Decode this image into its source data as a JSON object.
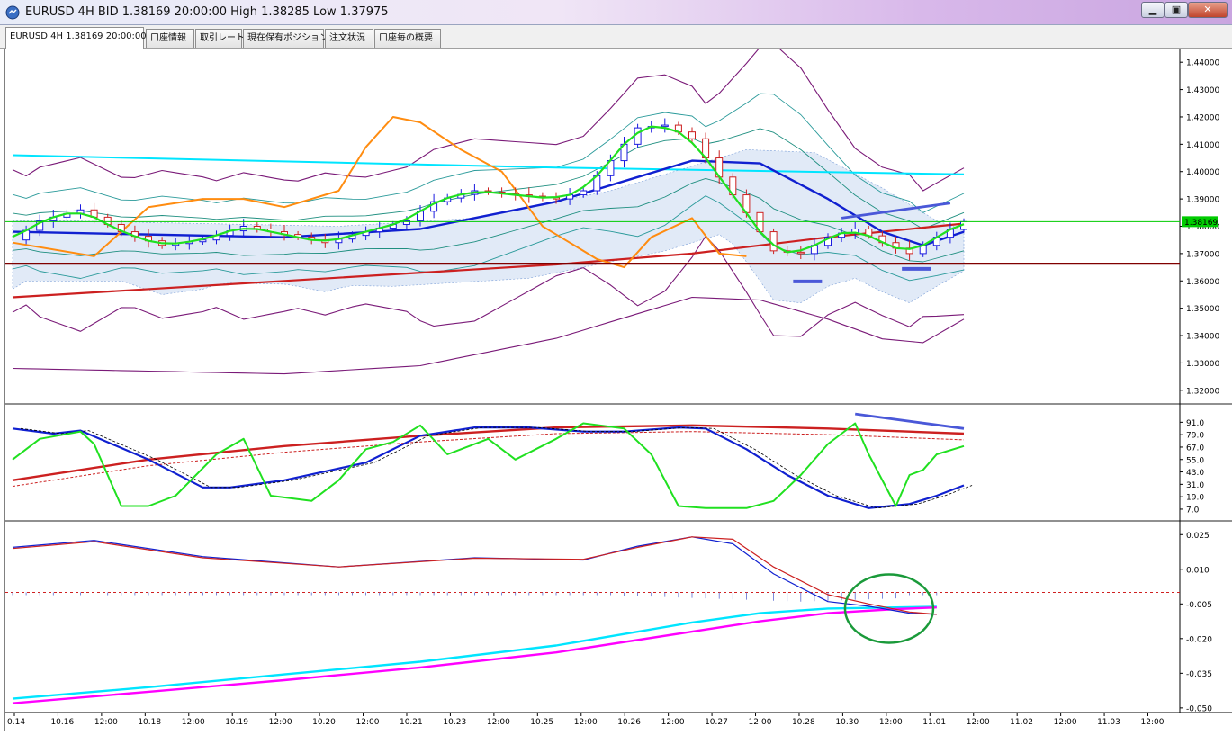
{
  "window": {
    "title": "EURUSD 4H BID 1.38169 20:00:00 High 1.38285 Low 1.37975",
    "controls": {
      "minimize": "▁",
      "maximize": "▣",
      "close": "✕"
    }
  },
  "tabs": [
    {
      "label": "EURUSD 4H 1.38169 20:00:00",
      "active": true
    },
    {
      "label": "口座情報"
    },
    {
      "label": "取引レート"
    },
    {
      "label": "現在保有ポジション"
    },
    {
      "label": "注文状況"
    },
    {
      "label": "口座毎の概要"
    }
  ],
  "chart_data": [
    {
      "type": "candlestick",
      "panel": "price",
      "symbol": "EURUSD",
      "timeframe": "4H",
      "ylim": [
        1.315,
        1.445
      ],
      "yticks": [
        "1.44000",
        "1.43000",
        "1.42000",
        "1.41000",
        "1.40000",
        "1.39000",
        "1.38000",
        "1.37000",
        "1.36000",
        "1.35000",
        "1.34000",
        "1.33000",
        "1.32000"
      ],
      "current_price_label": "1.38169",
      "current_price": 1.38169,
      "support_level": 1.3663,
      "grid": false,
      "series": [
        {
          "kind": "close_path",
          "x": [
            0,
            2,
            5,
            8,
            11,
            14,
            17,
            20,
            23,
            26,
            29,
            31,
            34,
            36,
            38,
            40,
            42,
            44,
            46,
            48,
            50,
            52,
            54,
            56,
            58,
            60,
            62,
            64,
            66,
            68,
            70
          ],
          "values": [
            1.375,
            1.382,
            1.386,
            1.378,
            1.373,
            1.375,
            1.38,
            1.377,
            1.374,
            1.378,
            1.382,
            1.389,
            1.393,
            1.392,
            1.391,
            1.39,
            1.393,
            1.404,
            1.416,
            1.417,
            1.412,
            1.398,
            1.385,
            1.371,
            1.37,
            1.376,
            1.379,
            1.374,
            1.37,
            1.376,
            1.3817
          ]
        },
        {
          "kind": "moving_average",
          "name": "long",
          "x": [
            0,
            20,
            40,
            50,
            60,
            70
          ],
          "values": [
            1.354,
            1.36,
            1.366,
            1.37,
            1.376,
            1.381
          ]
        },
        {
          "kind": "moving_average",
          "name": "mid",
          "x": [
            0,
            20,
            30,
            40,
            46,
            50,
            55,
            60,
            64,
            67,
            70
          ],
          "values": [
            1.378,
            1.376,
            1.379,
            1.389,
            1.398,
            1.404,
            1.403,
            1.39,
            1.378,
            1.373,
            1.378
          ]
        },
        {
          "kind": "horizontal_trend",
          "x": [
            0,
            40,
            70
          ],
          "values": [
            1.406,
            1.4015,
            1.399
          ]
        },
        {
          "kind": "lagging_span",
          "x": [
            0,
            6,
            10,
            14,
            17,
            20,
            24,
            26,
            28,
            30,
            33,
            36,
            39,
            41,
            43,
            45,
            47,
            50,
            52,
            54
          ],
          "values": [
            1.374,
            1.369,
            1.387,
            1.39,
            1.39,
            1.387,
            1.393,
            1.409,
            1.42,
            1.418,
            1.408,
            1.4,
            1.38,
            1.374,
            1.368,
            1.365,
            1.376,
            1.383,
            1.37,
            1.369
          ]
        }
      ],
      "trendlines": [
        {
          "x": [
            61,
            69
          ],
          "values": [
            1.383,
            1.3885
          ]
        }
      ],
      "markers": [
        {
          "x": 58.5,
          "value": 1.3598
        },
        {
          "x": 66.5,
          "value": 1.3644
        }
      ]
    },
    {
      "type": "line",
      "panel": "oscillator",
      "ylim": [
        0,
        100
      ],
      "yticks": [
        "91.0",
        "79.0",
        "67.0",
        "55.0",
        "43.0",
        "31.0",
        "19.0",
        "7.0"
      ],
      "series": [
        {
          "kind": "stochastic_fast",
          "x": [
            0,
            2,
            5,
            6,
            8,
            10,
            12,
            15,
            17,
            19,
            22,
            24,
            26,
            28,
            30,
            32,
            35,
            37,
            40,
            42,
            45,
            47,
            49,
            51,
            54,
            56,
            58,
            60,
            62,
            63,
            65,
            66,
            67,
            68,
            70
          ],
          "values": [
            55,
            75,
            82,
            70,
            10,
            10,
            20,
            60,
            75,
            20,
            15,
            35,
            65,
            72,
            88,
            60,
            75,
            55,
            75,
            90,
            85,
            60,
            10,
            8,
            8,
            15,
            40,
            70,
            90,
            60,
            10,
            40,
            45,
            60,
            68
          ]
        },
        {
          "kind": "stochastic_slow",
          "x": [
            0,
            3,
            5,
            10,
            14,
            16,
            20,
            26,
            30,
            34,
            38,
            42,
            45,
            49,
            51,
            54,
            57,
            60,
            63,
            66,
            68,
            70
          ],
          "values": [
            85,
            80,
            83,
            55,
            28,
            28,
            35,
            52,
            78,
            86,
            86,
            82,
            82,
            86,
            85,
            65,
            40,
            20,
            8,
            12,
            20,
            30
          ]
        },
        {
          "kind": "ma_red",
          "x": [
            0,
            10,
            20,
            30,
            40,
            50,
            60,
            70
          ],
          "values": [
            35,
            55,
            68,
            78,
            86,
            88,
            85,
            80
          ]
        }
      ],
      "trendlines": [
        {
          "x": [
            62,
            70
          ],
          "values": [
            99,
            85
          ]
        }
      ]
    },
    {
      "type": "line",
      "panel": "macd",
      "ylim": [
        -0.052,
        0.029
      ],
      "yticks": [
        "0.025",
        "0.010",
        "-0.005",
        "-0.020",
        "-0.035",
        "-0.050"
      ],
      "series": [
        {
          "kind": "main",
          "x": [
            0,
            6,
            14,
            24,
            34,
            42,
            46,
            50,
            53,
            56,
            60,
            63,
            66,
            68
          ],
          "values": [
            0.0195,
            0.0225,
            0.0155,
            0.011,
            0.015,
            0.014,
            0.02,
            0.024,
            0.021,
            0.008,
            -0.004,
            -0.006,
            -0.009,
            -0.0095
          ]
        },
        {
          "kind": "signal",
          "x": [
            0,
            6,
            14,
            24,
            34,
            42,
            46,
            50,
            53,
            56,
            60,
            63,
            66,
            68
          ],
          "values": [
            0.019,
            0.022,
            0.015,
            0.011,
            0.0148,
            0.0143,
            0.0195,
            0.024,
            0.023,
            0.011,
            -0.001,
            -0.005,
            -0.0085,
            -0.0095
          ]
        },
        {
          "kind": "cyan_line",
          "x": [
            0,
            10,
            20,
            30,
            40,
            50,
            55,
            60,
            65,
            68
          ],
          "values": [
            -0.046,
            -0.041,
            -0.0355,
            -0.03,
            -0.023,
            -0.013,
            -0.009,
            -0.007,
            -0.0065,
            -0.0062
          ]
        },
        {
          "kind": "magenta_line",
          "x": [
            0,
            10,
            20,
            30,
            40,
            50,
            55,
            60,
            65,
            68
          ],
          "values": [
            -0.048,
            -0.043,
            -0.038,
            -0.0325,
            -0.026,
            -0.017,
            -0.0125,
            -0.009,
            -0.0072,
            -0.0065
          ]
        }
      ],
      "reference_level": 0.0
    }
  ],
  "x_axis": {
    "labels": [
      "0.14",
      "10.16",
      "12:00",
      "10.18",
      "12:00",
      "10.19",
      "12:00",
      "10.20",
      "12:00",
      "10.21",
      "10.23",
      "12:00",
      "10.25",
      "12:00",
      "10.26",
      "12:00",
      "10.27",
      "12:00",
      "10.28",
      "10.30",
      "12:00",
      "11.01",
      "12:00",
      "11.02",
      "12:00",
      "11.03",
      "12:00"
    ]
  },
  "colors": {
    "bull": "#1a1adf",
    "bear": "#cc2020",
    "support": "#800000",
    "current_price": "#00cc00",
    "cyan": "#00e5ff",
    "magenta": "#ff00ff",
    "orange": "#ff8c10",
    "green": "#20e020",
    "blue": "#1020d0"
  }
}
